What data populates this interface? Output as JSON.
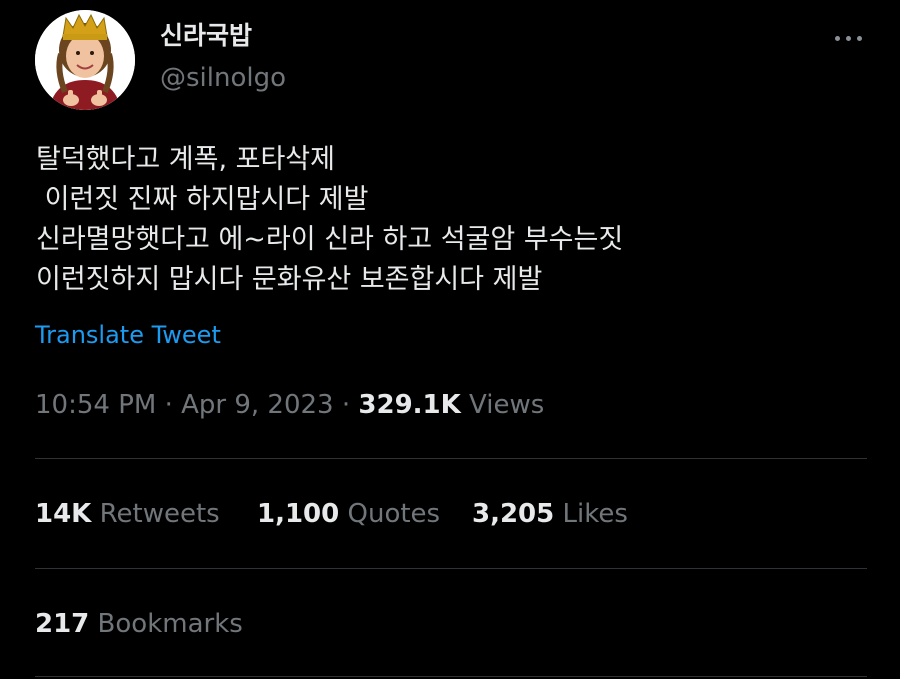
{
  "author": {
    "display_name": "신라국밥",
    "handle": "@silnolgo",
    "avatar_icon": "child-with-golden-crown-avatar"
  },
  "tweet": {
    "lines": [
      "탈덕했다고 계폭, 포타삭제",
      " 이런짓 진짜 하지맙시다 제발",
      "신라멸망햇다고 에~라이 신라 하고 석굴암 부수는짓",
      "이런짓하지 맙시다 문화유산 보존합시다 제발"
    ],
    "translate_label": "Translate Tweet"
  },
  "meta": {
    "time": "10:54 PM",
    "separator": "·",
    "date": "Apr 9, 2023",
    "views_count": "329.1K",
    "views_label": "Views"
  },
  "stats": {
    "retweets_count": "14K",
    "retweets_label": "Retweets",
    "quotes_count": "1,100",
    "quotes_label": "Quotes",
    "likes_count": "3,205",
    "likes_label": "Likes",
    "bookmarks_count": "217",
    "bookmarks_label": "Bookmarks"
  },
  "colors": {
    "background": "#000000",
    "text_primary": "#e7e9ea",
    "text_secondary": "#71767b",
    "link": "#1d9bf0",
    "divider": "#2f3336"
  }
}
